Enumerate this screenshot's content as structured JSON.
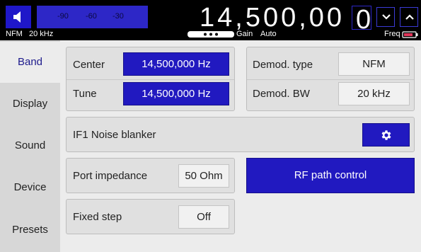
{
  "topbar": {
    "meter_ticks": [
      "-90",
      "-60",
      "-30"
    ],
    "mode": "NFM",
    "bandwidth": "20 kHz",
    "frequency_digits": "14,500,00",
    "cursor_digit": "0",
    "gain_label": "Gain",
    "gain_mode": "Auto",
    "freq_label": "Freq"
  },
  "sidebar": {
    "items": [
      {
        "label": "Band",
        "active": true
      },
      {
        "label": "Display",
        "active": false
      },
      {
        "label": "Sound",
        "active": false
      },
      {
        "label": "Device",
        "active": false
      },
      {
        "label": "Presets",
        "active": false
      }
    ]
  },
  "band_panel": {
    "center_label": "Center",
    "center_value": "14,500,000 Hz",
    "tune_label": "Tune",
    "tune_value": "14,500,000 Hz"
  },
  "demod_panel": {
    "type_label": "Demod. type",
    "type_value": "NFM",
    "bw_label": "Demod. BW",
    "bw_value": "20 kHz"
  },
  "noise_blanker": {
    "label": "IF1 Noise blanker"
  },
  "port_impedance": {
    "label": "Port impedance",
    "value": "50 Ohm"
  },
  "rf_path": {
    "label": "RF path control"
  },
  "fixed_step": {
    "label": "Fixed step",
    "value": "Off"
  },
  "colors": {
    "accent": "#2119c0",
    "topbar_bg": "#000000",
    "sidebar_bg": "#d7d7d7"
  }
}
